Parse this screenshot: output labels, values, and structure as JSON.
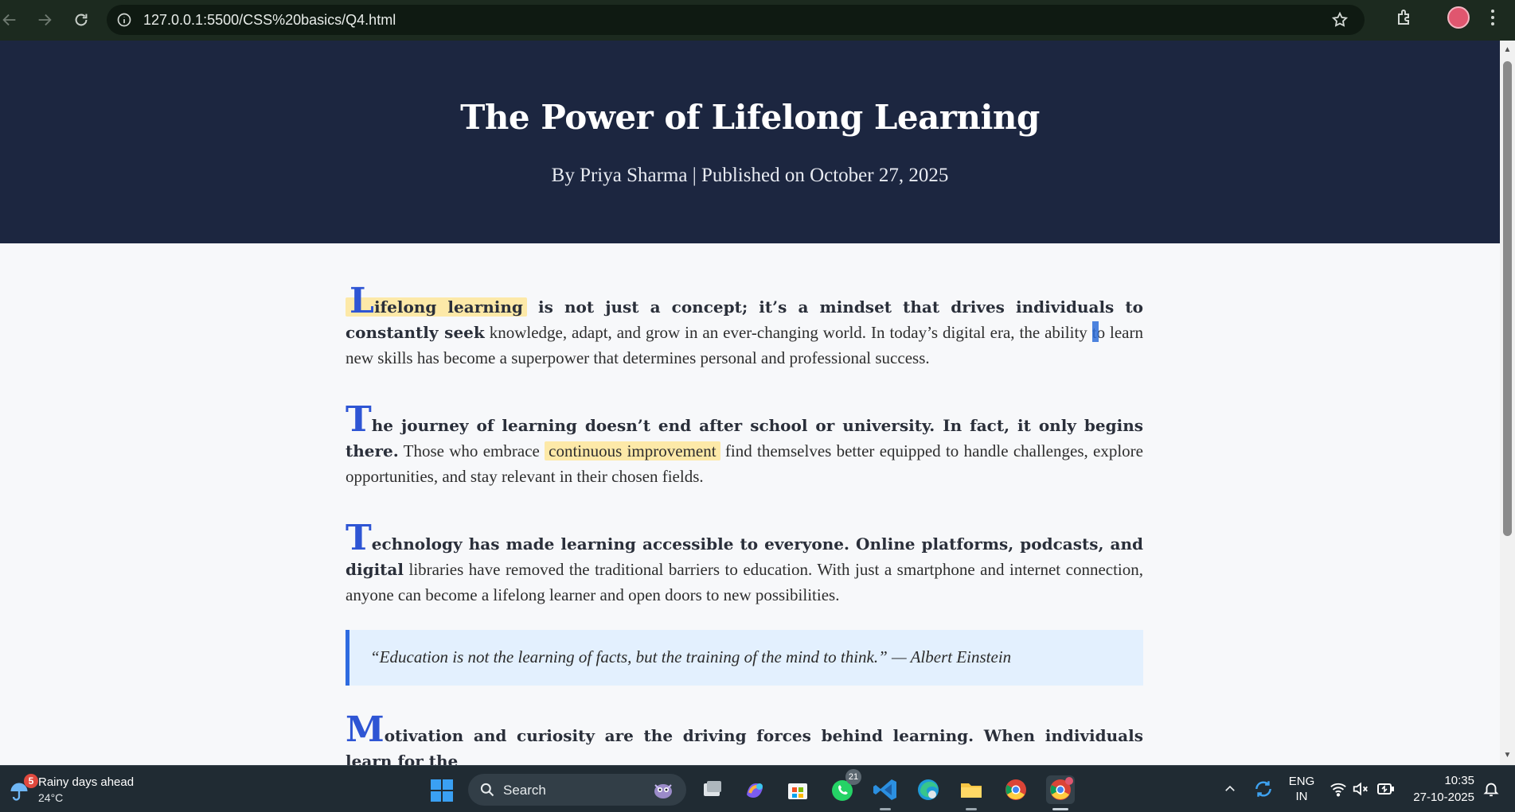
{
  "browser": {
    "url": "127.0.0.1:5500/CSS%20basics/Q4.html",
    "icons": [
      "back-icon",
      "forward-icon",
      "reload-icon",
      "site-info-icon",
      "bookmark-star-icon",
      "extensions-icon",
      "profile-avatar",
      "more-menu-icon"
    ]
  },
  "page": {
    "title": "The Power of Lifelong Learning",
    "byline": "By Priya Sharma | Published on October 27, 2025",
    "paragraphs": [
      {
        "dropcap": "L",
        "highlight": "ifelong learning",
        "lead_rest": "is not just a concept; it’s a mindset that drives individuals to constantly seek",
        "body_before_cursor": "knowledge, adapt, and grow in an ever-changing world. In today’s digital era, the ability ",
        "body_after_cursor": "to learn new skills has become a superpower that determines personal and professional success."
      },
      {
        "dropcap": "T",
        "lead": "he journey of learning doesn’t end after school or university. In fact, it only begins there.",
        "body_before": "Those who embrace",
        "highlight": "continuous improvement",
        "body_after": "find themselves better equipped to handle challenges, explore opportunities, and stay relevant in their chosen fields."
      },
      {
        "dropcap": "T",
        "lead": "echnology has made learning accessible to everyone. Online platforms, podcasts, and digital",
        "body": "libraries have removed the traditional barriers to education. With just a smartphone and internet connection, anyone can become a lifelong learner and open doors to new possibilities."
      }
    ],
    "quote": "“Education is not the learning of facts, but the training of the mind to think.” — Albert Einstein",
    "cut_paragraph": {
      "dropcap": "M",
      "lead": "otivation and curiosity are the driving forces behind learning. When individuals learn for the"
    }
  },
  "colors": {
    "hero_bg": "#1c2640",
    "dropcap": "#2e55d4",
    "highlight": "#fde9a8",
    "quote_bg": "#e3f0fe",
    "quote_border": "#2e6be0"
  },
  "taskbar": {
    "weather_badge": "5",
    "weather_title": "Rainy days ahead",
    "weather_temp": "24°C",
    "search_label": "Search",
    "whatsapp_badge": "21",
    "apps": [
      "windows-start",
      "task-view",
      "copilot",
      "microsoft-store",
      "whatsapp",
      "vscode",
      "edge",
      "file-explorer",
      "chrome",
      "chrome-active"
    ],
    "lang_line1": "ENG",
    "lang_line2": "IN",
    "time": "10:35",
    "date": "27-10-2025"
  }
}
